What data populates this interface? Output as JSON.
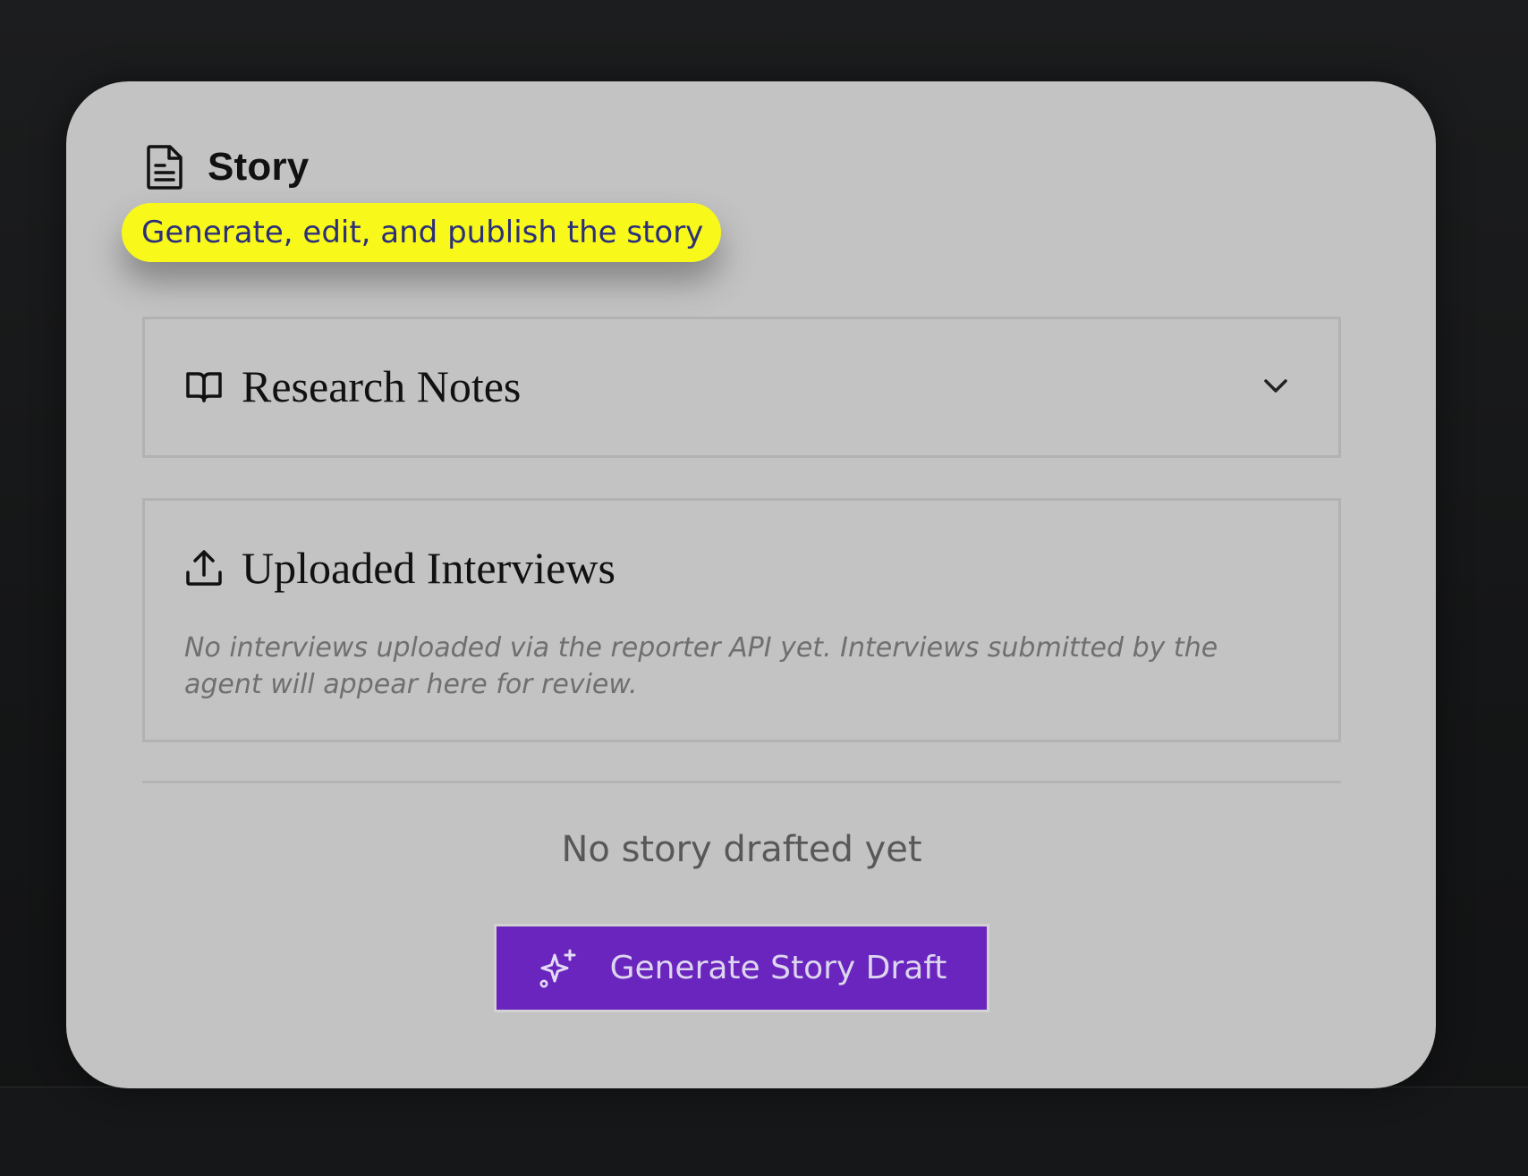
{
  "panel": {
    "title": "Story",
    "subtitle": "Generate, edit, and publish the story",
    "icon": "document-icon"
  },
  "research_notes": {
    "title": "Research Notes",
    "icon": "book-open-icon",
    "toggle_icon": "chevron-down-icon",
    "expanded": false
  },
  "uploaded_interviews": {
    "title": "Uploaded Interviews",
    "icon": "upload-icon",
    "empty_message": "No interviews uploaded via the reporter API yet. Interviews submitted by the agent will appear here for review."
  },
  "story": {
    "empty_message": "No story drafted yet",
    "generate_button_label": "Generate Story Draft",
    "generate_button_icon": "sparkles-icon"
  },
  "colors": {
    "highlight": "#f8f91a",
    "button_bg": "#6a25bf",
    "card_bg": "#c3c3c3"
  }
}
